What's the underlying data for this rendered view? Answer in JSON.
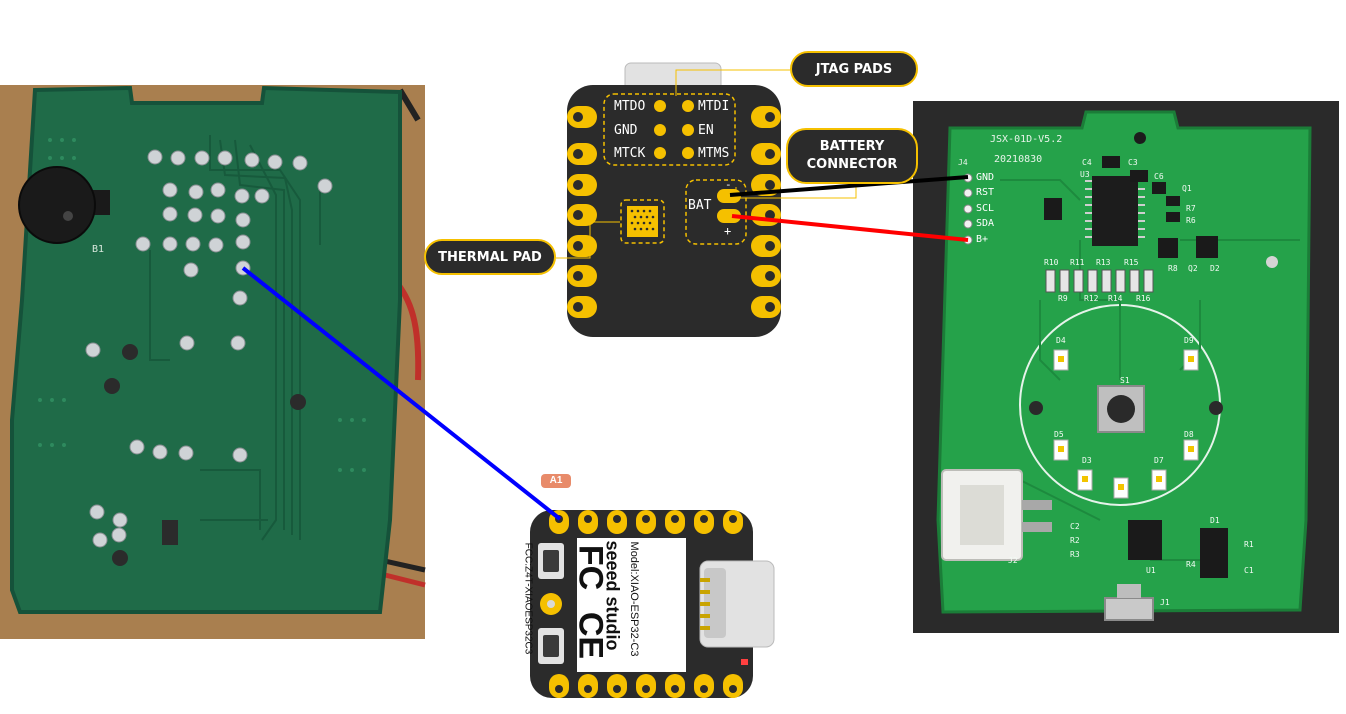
{
  "callouts": {
    "jtag": "JTAG PADS",
    "battery_line1": "BATTERY",
    "battery_line2": "CONNECTOR",
    "thermal": "THERMAL PAD"
  },
  "xiao_back": {
    "pins_left": [
      "MTDO",
      "GND",
      "MTCK"
    ],
    "pins_right": [
      "MTDI",
      "EN",
      "MTMS"
    ],
    "bat_label": "BAT",
    "bat_minus": "-",
    "bat_plus": "+"
  },
  "xiao_front": {
    "pin_tag": "A1",
    "brand": "seeed studio",
    "model": "Model:XIAO-ESP32-C3",
    "fcc_id": "FCC:Z4T-XIAOESP32C3",
    "fcc_mark": "FC",
    "ce_mark": "CE"
  },
  "right_pcb": {
    "board_name": "JSX-01D-V5.2",
    "board_date": "20210830",
    "connector_ref": "J4",
    "connector_pins": [
      "GND",
      "RST",
      "SCL",
      "SDA",
      "B+"
    ],
    "refs": [
      "C4",
      "C3",
      "U3",
      "C6",
      "Q1",
      "R7",
      "R6",
      "R8",
      "Q2",
      "D2",
      "R10",
      "R11",
      "R13",
      "R15",
      "R9",
      "R12",
      "R14",
      "R16",
      "D4",
      "D9",
      "S1",
      "D5",
      "D8",
      "D3",
      "D7",
      "C2",
      "R2",
      "R3",
      "U1",
      "R4",
      "D1",
      "R1",
      "C1",
      "J1",
      "J2"
    ]
  },
  "left_pcb": {
    "buzzer_ref": "B1"
  },
  "colors": {
    "xiao_body": "#2b2b2b",
    "pad_gold": "#f5c000",
    "pcb_green_left": "#1f6b48",
    "pcb_green_right": "#25a24a",
    "wire_blue": "#0000ff",
    "wire_red": "#ff0000",
    "wire_black": "#000000",
    "callout_bg": "#2b2b2b",
    "callout_border": "#f5c000"
  }
}
